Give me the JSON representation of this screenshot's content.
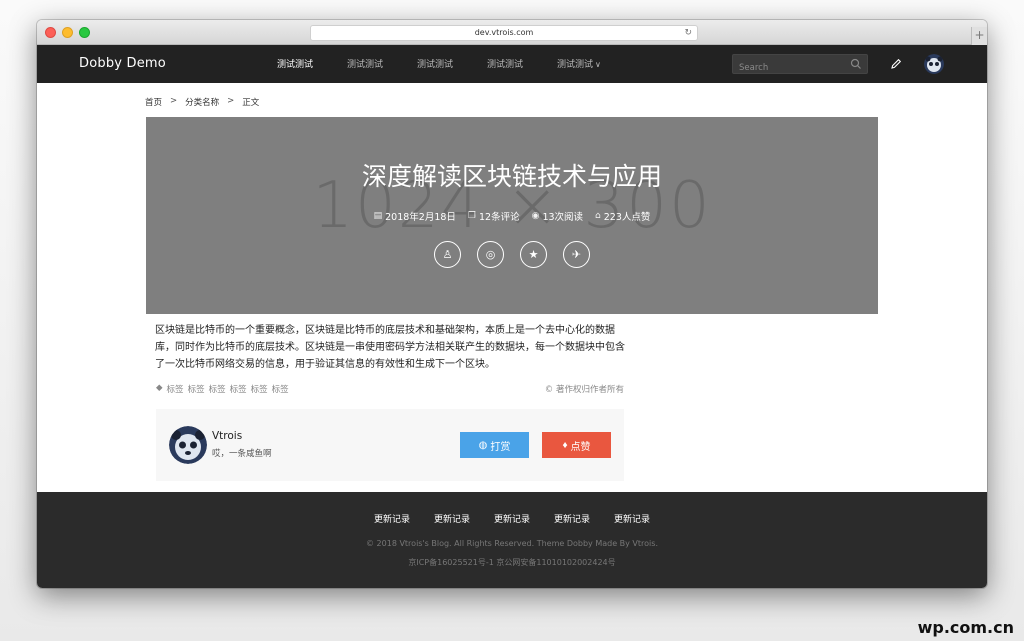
{
  "browser": {
    "url": "dev.vtrois.com"
  },
  "nav": {
    "brand": "Dobby Demo",
    "links": [
      "测试测试",
      "测试测试",
      "测试测试",
      "测试测试",
      "测试测试"
    ],
    "search_placeholder": "Search"
  },
  "breadcrumb": {
    "items": [
      "首页",
      "分类名称",
      "正文"
    ],
    "separator": ">"
  },
  "hero": {
    "placeholder_text": "1024 × 300",
    "title": "深度解读区块链技术与应用",
    "date": "2018年2月18日",
    "comments": "12条评论",
    "reads": "13次阅读",
    "likes": "223人点赞"
  },
  "article": {
    "body": "区块链是比特币的一个重要概念，区块链是比特币的底层技术和基础架构，本质上是一个去中心化的数据库，同时作为比特币的底层技术。区块链是一串使用密码学方法相关联产生的数据块，每一个数据块中包含了一次比特币网络交易的信息，用于验证其信息的有效性和生成下一个区块。",
    "tags": [
      "标签",
      "标签",
      "标签",
      "标签",
      "标签",
      "标签"
    ],
    "copyright": "© 著作权归作者所有"
  },
  "author": {
    "name": "Vtrois",
    "bio": "哎，一条咸鱼啊",
    "tip_label": "打赏",
    "like_label": "点赞"
  },
  "footer": {
    "links": [
      "更新记录",
      "更新记录",
      "更新记录",
      "更新记录",
      "更新记录"
    ],
    "copyright": "© 2018 Vtrois's Blog. All Rights Reserved. Theme Dobby Made By Vtrois.",
    "icp": "京ICP备16025521号-1 京公网安备11010102002424号"
  },
  "watermark": "wp.com.cn",
  "colors": {
    "nav_bg": "#222222",
    "hero_bg": "#7f7f7f",
    "tip_button": "#4aa3e8",
    "like_button": "#e9573f",
    "footer_bg": "#2b2b2b"
  }
}
